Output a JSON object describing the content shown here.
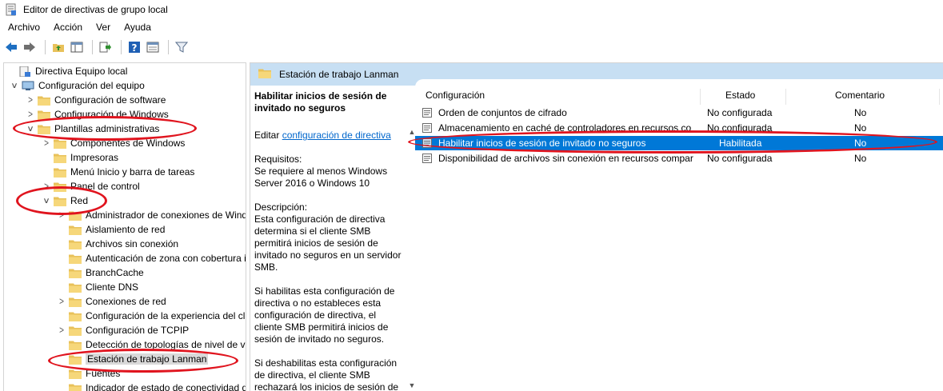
{
  "window": {
    "title": "Editor de directivas de grupo local"
  },
  "menu": [
    "Archivo",
    "Acción",
    "Ver",
    "Ayuda"
  ],
  "toolbar": [
    "back-arrow-icon",
    "forward-arrow-icon",
    "up-folder-icon",
    "show-hide-tree-icon",
    "export-list-icon",
    "help-icon",
    "properties-icon",
    "filter-icon"
  ],
  "tree": {
    "root": "Directiva Equipo local",
    "computer_config": "Configuración del equipo",
    "software": "Configuración de software",
    "windows": "Configuración de Windows",
    "admin_templates": "Plantillas administrativas",
    "windows_components": "Componentes de Windows",
    "printers": "Impresoras",
    "start_menu": "Menú Inicio y barra de tareas",
    "control_panel": "Panel de control",
    "network": "Red",
    "network_children": [
      "Administrador de conexiones de Wind",
      "Aislamiento de red",
      "Archivos sin conexión",
      "Autenticación de zona con cobertura i",
      "BranchCache",
      "Cliente DNS",
      "Conexiones de red",
      "Configuración de la experiencia del cli",
      "Configuración de TCPIP",
      "Detección de topologías de nivel de vi",
      "Estación de trabajo Lanman",
      "Fuentes",
      "Indicador de estado de conectividad d"
    ]
  },
  "right_header": "Estación de trabajo Lanman",
  "description": {
    "title": "Habilitar inicios de sesión de invitado no seguros",
    "edit_prefix": "Editar ",
    "edit_link": "configuración de directiva",
    "requirements": "Requisitos:\nSe requiere al menos Windows Server 2016 o Windows 10",
    "desc": "Descripción:\nEsta configuración de directiva determina si el cliente SMB permitirá inicios de sesión de invitado no seguros en un servidor SMB.",
    "enabled": "Si habilitas esta configuración de directiva o no estableces esta configuración de directiva, el cliente SMB permitirá inicios de sesión de invitado no seguros.",
    "disabled": "Si deshabilitas esta configuración de directiva, el cliente SMB rechazará los inicios de sesión de"
  },
  "list": {
    "columns": {
      "setting": "Configuración",
      "state": "Estado",
      "comment": "Comentario"
    },
    "rows": [
      {
        "setting": "Orden de conjuntos de cifrado",
        "state": "No configurada",
        "comment": "No"
      },
      {
        "setting": "Almacenamiento en caché de controladores en recursos co",
        "state": "No configurada",
        "comment": "No"
      },
      {
        "setting": "Habilitar inicios de sesión de invitado no seguros",
        "state": "Habilitada",
        "comment": "No"
      },
      {
        "setting": "Disponibilidad de archivos sin conexión en recursos compar",
        "state": "No configurada",
        "comment": "No"
      }
    ]
  },
  "colors": {
    "selection": "#0078d7",
    "header_bg": "#c7dff3",
    "annotation": "#e0141e",
    "link": "#0066cc"
  }
}
